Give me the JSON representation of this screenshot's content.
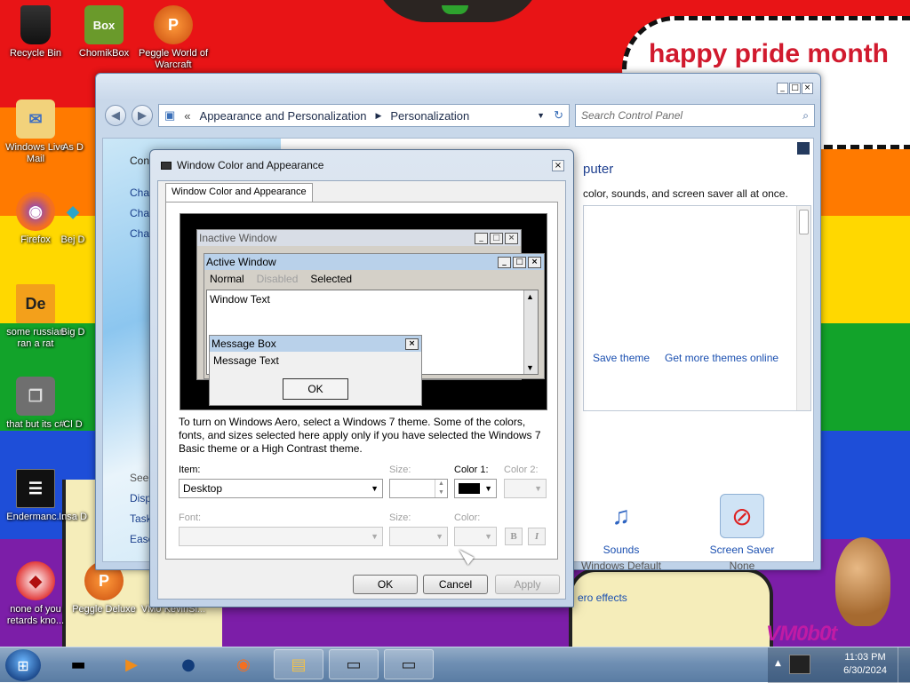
{
  "desktop": {
    "bubble_text": "happy pride month",
    "vm_logo": "VM0b0t",
    "icons": [
      {
        "label": "Recycle Bin",
        "glyph": "",
        "color": "#1e1e1e"
      },
      {
        "label": "ChomikBox",
        "glyph": "Box",
        "color": "#6a9a2b"
      },
      {
        "label": "Peggle World of Warcraft",
        "glyph": "P",
        "color": "#e06a14"
      },
      {
        "label": "Windows Live Mail",
        "glyph": "✉",
        "color": "#f2c14b"
      },
      {
        "label": "Firefox",
        "glyph": "◉",
        "color": "#f36f21"
      },
      {
        "label": "some russian ran a rat",
        "glyph": "De",
        "color": "#f3a01b"
      },
      {
        "label": "that but its c#",
        "glyph": "❐",
        "color": "#555555"
      },
      {
        "label": "Endermanc...",
        "glyph": "☰",
        "color": "#111111"
      },
      {
        "label": "none of you retards kno...",
        "glyph": "◆",
        "color": "#d83030"
      },
      {
        "label": "Peggle Deluxe",
        "glyph": "P",
        "color": "#e06a14"
      },
      {
        "label": "VM0 KevinSi...",
        "glyph": "",
        "color": "transparent"
      },
      {
        "label": "As D",
        "glyph": "",
        "color": "transparent"
      },
      {
        "label": "Bej D",
        "glyph": "◆",
        "color": "#2aa5c9"
      },
      {
        "label": "Big D",
        "glyph": "",
        "color": "transparent"
      },
      {
        "label": "Cl D",
        "glyph": "",
        "color": "transparent"
      },
      {
        "label": "Insa D",
        "glyph": "",
        "color": "transparent"
      }
    ]
  },
  "control_panel": {
    "breadcrumb": [
      "Appearance and Personalization",
      "Personalization"
    ],
    "search_placeholder": "Search Control Panel",
    "left_links": [
      "Con",
      "Chan",
      "Chan",
      "Chan"
    ],
    "see_also_links": [
      "See a",
      "Displ",
      "Task",
      "Ease"
    ],
    "heading_partial": "puter",
    "description_partial": "color, sounds, and screen saver all at once.",
    "save_theme": "Save theme",
    "get_more_themes": "Get more themes online",
    "sounds": {
      "title": "Sounds",
      "subtitle": "Windows Default"
    },
    "screen_saver": {
      "title": "Screen Saver",
      "subtitle": "None"
    },
    "aero_effects_partial": "ero effects"
  },
  "dialog": {
    "title": "Window Color and Appearance",
    "tab_label": "Window Color and Appearance",
    "preview": {
      "inactive_title": "Inactive Window",
      "active_title": "Active Window",
      "menu_normal": "Normal",
      "menu_disabled": "Disabled",
      "menu_selected": "Selected",
      "window_text": "Window Text",
      "msgbox_title": "Message Box",
      "msgbox_text": "Message Text",
      "msgbox_ok": "OK"
    },
    "note": "To turn on Windows Aero, select a Windows 7 theme.  Some of the colors, fonts, and sizes selected here apply only if you have selected the Windows 7 Basic theme or a High Contrast theme.",
    "item_label": "Item:",
    "item_value": "Desktop",
    "size_label": "Size:",
    "color1_label": "Color 1:",
    "color1_value": "#000000",
    "color2_label": "Color 2:",
    "font_label": "Font:",
    "font_size_label": "Size:",
    "font_color_label": "Color:",
    "bold_label": "B",
    "italic_label": "I",
    "ok": "OK",
    "cancel": "Cancel",
    "apply": "Apply"
  },
  "taskbar": {
    "time": "11:03 PM",
    "date": "6/30/2024",
    "items": [
      {
        "icon": "▬",
        "open": false
      },
      {
        "icon": "▶",
        "open": false
      },
      {
        "icon": "●",
        "open": false
      },
      {
        "icon": "◉",
        "open": false
      },
      {
        "icon": "▤",
        "open": true
      },
      {
        "icon": "▭",
        "open": true
      },
      {
        "icon": "▭",
        "open": true
      }
    ]
  },
  "colors": {
    "pride": [
      "#e81416",
      "#ff7a00",
      "#ffd800",
      "#12a32a",
      "#1e4ed8",
      "#7c1ea8"
    ],
    "active_title": "#b9d1ea",
    "inactive_title": "#d8dde6",
    "msgbox_title": "#b9d1ea"
  }
}
